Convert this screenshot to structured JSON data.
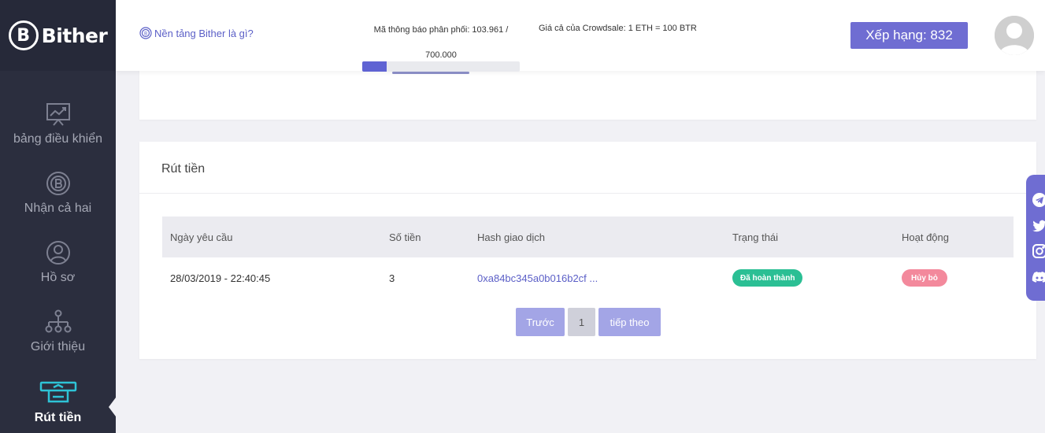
{
  "brand": {
    "logo_letter": "B",
    "name": "Bither"
  },
  "sidebar": {
    "items": [
      {
        "label": "bảng điều khiển",
        "icon": "dashboard-chart-icon"
      },
      {
        "label": "Nhận cả hai",
        "icon": "coin-icon"
      },
      {
        "label": "Hồ sơ",
        "icon": "user-icon"
      },
      {
        "label": "Giới thiệu",
        "icon": "referral-tree-icon"
      },
      {
        "label": "Rút tiền",
        "icon": "withdraw-icon",
        "active": true
      }
    ]
  },
  "header": {
    "what_is_link": "Nền tảng Bither là gì?",
    "token_line1": "Mã thông báo phân phối: 103.961 /",
    "token_line2": "700.000",
    "price_info": "Giá cả của Crowdsale: 1 ETH = 100 BTR",
    "distribution_progress": 0.155,
    "rank_label": "Xếp hạng: 832"
  },
  "withdraw": {
    "title": "Rút tiền",
    "columns": [
      "Ngày yêu cầu",
      "Số tiền",
      "Hash giao dịch",
      "Trạng thái",
      "Hoạt động"
    ],
    "rows": [
      {
        "date": "28/03/2019 - 22:40:45",
        "amount": "3",
        "hash": "0xa84bc345a0b016b2cf ...",
        "status": "Đã hoàn thành",
        "action": "Hủy bỏ"
      }
    ],
    "pagination": {
      "prev": "Trước",
      "page": "1",
      "next": "tiếp theo"
    }
  },
  "colors": {
    "sidebar_bg": "#2b2e3e",
    "accent": "#6f6dd2",
    "status_done": "#2bbf94",
    "action_cancel": "#f3899c",
    "link": "#5b5fc7"
  },
  "social": [
    "telegram-icon",
    "twitter-icon",
    "instagram-icon",
    "discord-icon"
  ]
}
